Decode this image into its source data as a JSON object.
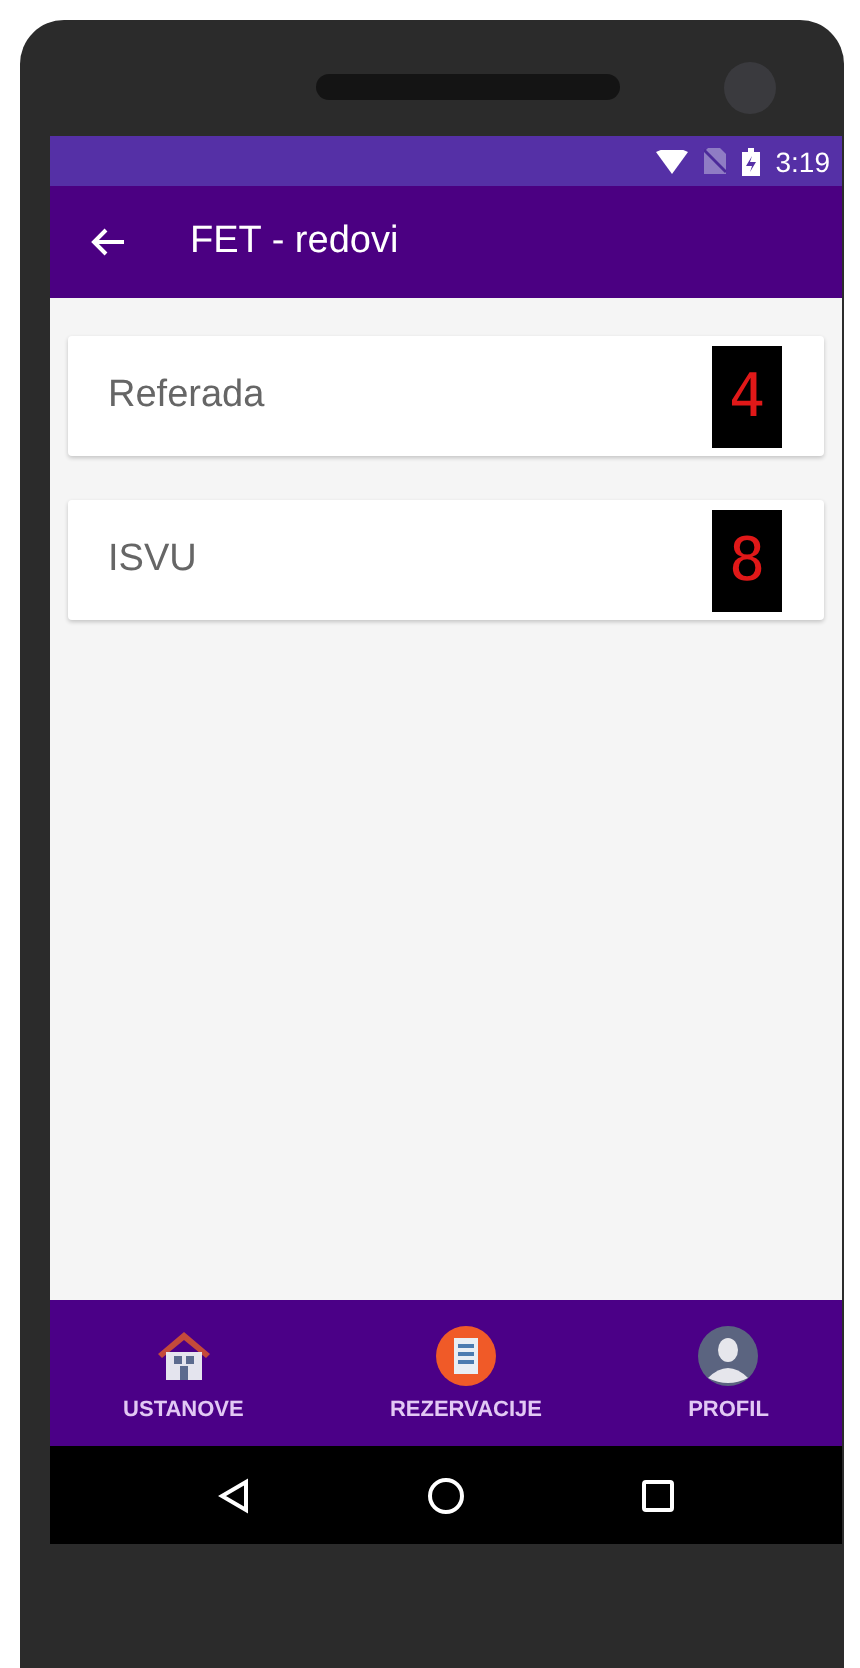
{
  "status_bar": {
    "time": "3:19"
  },
  "toolbar": {
    "title": "FET - redovi"
  },
  "items": [
    {
      "label": "Referada",
      "count": "4"
    },
    {
      "label": "ISVU",
      "count": "8"
    }
  ],
  "bottom_nav": [
    {
      "label": "USTANOVE",
      "kind": "house"
    },
    {
      "label": "REZERVACIJE",
      "kind": "ticket"
    },
    {
      "label": "PROFIL",
      "kind": "person"
    }
  ]
}
